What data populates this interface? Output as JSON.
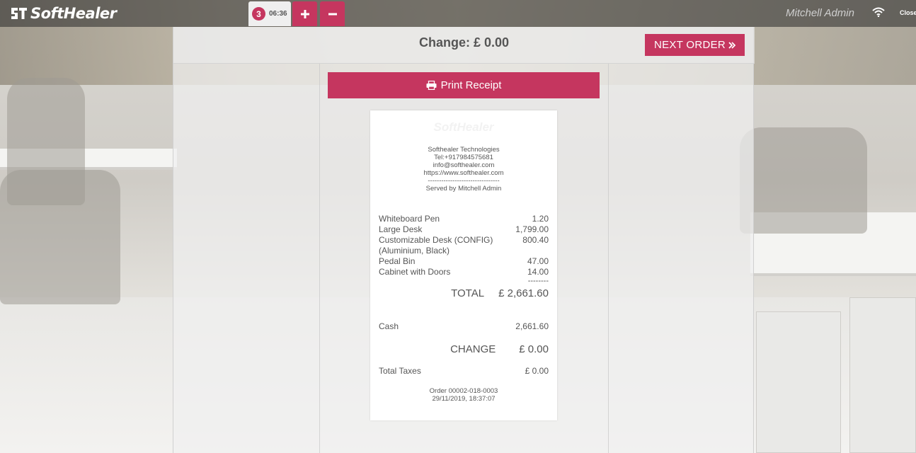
{
  "header": {
    "logo_text": "SoftHealer",
    "order_count": "3",
    "order_time": "06:36",
    "add_label": "+",
    "remove_label": "−",
    "user_name": "Mitchell Admin",
    "close_label": "Close"
  },
  "main": {
    "change_title": "Change: £ 0.00",
    "next_order_label": "NEXT ORDER",
    "print_receipt_label": "Print Receipt"
  },
  "receipt": {
    "logo_text": "SoftHealer",
    "company": "Softhealer Technologies",
    "tel": "Tel:+917984575681",
    "email": "info@softhealer.com",
    "website": "https://www.softhealer.com",
    "separator": "--------------------------------",
    "served_by": "Served by Mitchell Admin",
    "lines": [
      {
        "name": "Whiteboard Pen",
        "price": "1.20"
      },
      {
        "name": "Large Desk",
        "price": "1,799.00"
      },
      {
        "name": "Customizable Desk (CONFIG) (Aluminium, Black)",
        "price": "800.40"
      },
      {
        "name": "Pedal Bin",
        "price": "47.00"
      },
      {
        "name": "Cabinet with Doors",
        "price": "14.00"
      }
    ],
    "dash": "--------",
    "total_label": "TOTAL",
    "total_value": "£ 2,661.60",
    "cash_label": "Cash",
    "cash_value": "2,661.60",
    "change_label": "CHANGE",
    "change_value": "£ 0.00",
    "taxes_label": "Total Taxes",
    "taxes_value": "£ 0.00",
    "order_ref": "Order 00002-018-0003",
    "order_date": "29/11/2019, 18:37:07"
  },
  "colors": {
    "accent": "#c5365f"
  }
}
